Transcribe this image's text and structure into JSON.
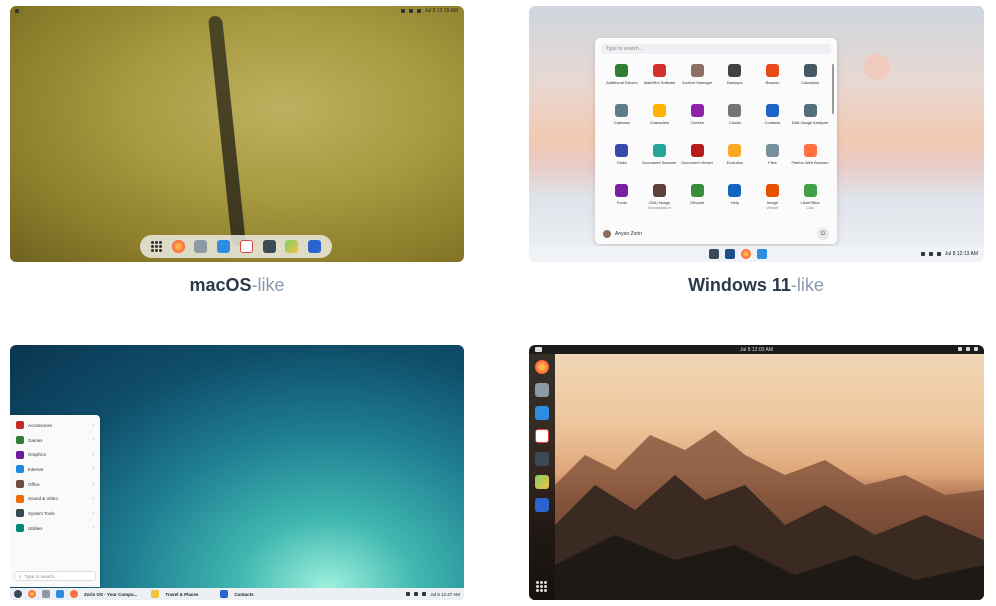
{
  "panels": [
    {
      "caption_main": "macOS",
      "caption_suffix": "-like",
      "topbar_time": "Jul 8 12:16 AM"
    },
    {
      "caption_main": "Windows 11",
      "caption_suffix": "-like",
      "search_placeholder": "Type to search...",
      "user_name": "Anyeo Zorin",
      "taskbar_time": "Jul 8 12:13 AM",
      "apps": [
        {
          "name": "Additional Drivers",
          "color": "#2e7d32"
        },
        {
          "name": "AisleRiot Solitaire",
          "color": "#d32f2f"
        },
        {
          "name": "Archive Manager",
          "color": "#8d6e63"
        },
        {
          "name": "Backups",
          "color": "#424242"
        },
        {
          "name": "Brasero",
          "color": "#e64a19"
        },
        {
          "name": "Calculator",
          "color": "#455a64"
        },
        {
          "name": "Calendar",
          "color": "#607d8b"
        },
        {
          "name": "Characters",
          "color": "#ffb300"
        },
        {
          "name": "Cheese",
          "color": "#8e24aa"
        },
        {
          "name": "Clocks",
          "color": "#757575"
        },
        {
          "name": "Contacts",
          "color": "#1e63c6"
        },
        {
          "name": "Disk Usage Analyzer",
          "color": "#546e7a"
        },
        {
          "name": "Disks",
          "color": "#3949ab"
        },
        {
          "name": "Document Scanner",
          "color": "#26a69a"
        },
        {
          "name": "Document Viewer",
          "color": "#b71c1c"
        },
        {
          "name": "Evolution",
          "color": "#f9a825"
        },
        {
          "name": "Files",
          "color": "#78909c"
        },
        {
          "name": "Firefox Web Browser",
          "color": "#ff7043"
        },
        {
          "name": "Fonts",
          "color": "#7b1fa2"
        },
        {
          "name": "GNU Image",
          "sub": "Manipulation",
          "color": "#5d4037"
        },
        {
          "name": "Gthumb",
          "color": "#388e3c"
        },
        {
          "name": "Help",
          "color": "#1565c0"
        },
        {
          "name": "Image",
          "sub": "Viewer",
          "color": "#e65100"
        },
        {
          "name": "LibreOffice",
          "sub": "Calc",
          "color": "#43a047"
        }
      ]
    },
    {
      "search_placeholder": "Type to search...",
      "taskbar_time": "Jul 8 12:47 AM",
      "window_tabs": [
        "Zorin OS - Your Compu...",
        "Travel & Places",
        "Contacts"
      ],
      "categories": [
        {
          "label": "Accessories",
          "color": "#c62828"
        },
        {
          "label": "Games",
          "color": "#2e7d32"
        },
        {
          "label": "Graphics",
          "color": "#6a1b9a"
        },
        {
          "label": "Internet",
          "color": "#1e88e5"
        },
        {
          "label": "Office",
          "color": "#6d4c41"
        },
        {
          "label": "Sound & Video",
          "color": "#ef6c00"
        },
        {
          "label": "System Tools",
          "color": "#37474f"
        },
        {
          "label": "Utilities",
          "color": "#00897b"
        }
      ]
    },
    {
      "topbar_time": "Jul 8 12:03 AM"
    }
  ],
  "colors": {
    "caption_dark": "#2b3a4a",
    "caption_light": "#8a9ab0"
  }
}
